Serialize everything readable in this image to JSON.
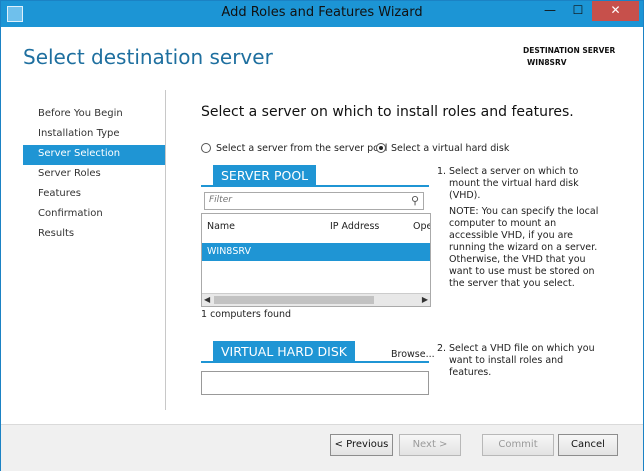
{
  "window": {
    "title": "Add Roles and Features Wizard",
    "minimize_glyph": "—",
    "maximize_glyph": "☐",
    "close_glyph": "✕"
  },
  "page": {
    "heading": "Select destination server",
    "destination_label": "DESTINATION SERVER",
    "destination_server": "WIN8SRV"
  },
  "nav": {
    "items": [
      {
        "label": "Before You Begin"
      },
      {
        "label": "Installation Type"
      },
      {
        "label": "Server Selection"
      },
      {
        "label": "Server Roles"
      },
      {
        "label": "Features"
      },
      {
        "label": "Confirmation"
      },
      {
        "label": "Results"
      }
    ],
    "active_index": 2
  },
  "main": {
    "title": "Select a server on which to install roles and features.",
    "radio_pool": "Select a server from the server pool",
    "radio_vhd": "Select a virtual hard disk",
    "selected_option": "vhd"
  },
  "server_pool": {
    "heading": "SERVER POOL",
    "filter_placeholder": "Filter",
    "columns": [
      "Name",
      "IP Address",
      "Ope"
    ],
    "rows": [
      {
        "name": "WIN8SRV",
        "ip": "",
        "os": ""
      }
    ],
    "count_text": "1 computers found",
    "scroll_left": "◀",
    "scroll_right": "▶",
    "search_glyph": "⚲"
  },
  "vhd": {
    "heading": "VIRTUAL HARD DISK",
    "browse_label": "Browse...",
    "path_value": ""
  },
  "steps": [
    {
      "num": "1.",
      "text": "Select a server on which to mount the virtual hard disk (VHD)."
    },
    {
      "num": "",
      "text": "NOTE: You can specify the local computer to mount an accessible VHD, if you are running the wizard on a server. Otherwise, the VHD that you want to use must be stored on the server that you select."
    },
    {
      "num": "2.",
      "text": "Select a VHD file on which you want to install roles and features."
    }
  ],
  "buttons": {
    "previous": "< Previous",
    "next": "Next >",
    "commit": "Commit",
    "cancel": "Cancel"
  },
  "colors": {
    "accent": "#1f95d4",
    "titlebar": "#1c95d5",
    "close": "#c7504b"
  }
}
